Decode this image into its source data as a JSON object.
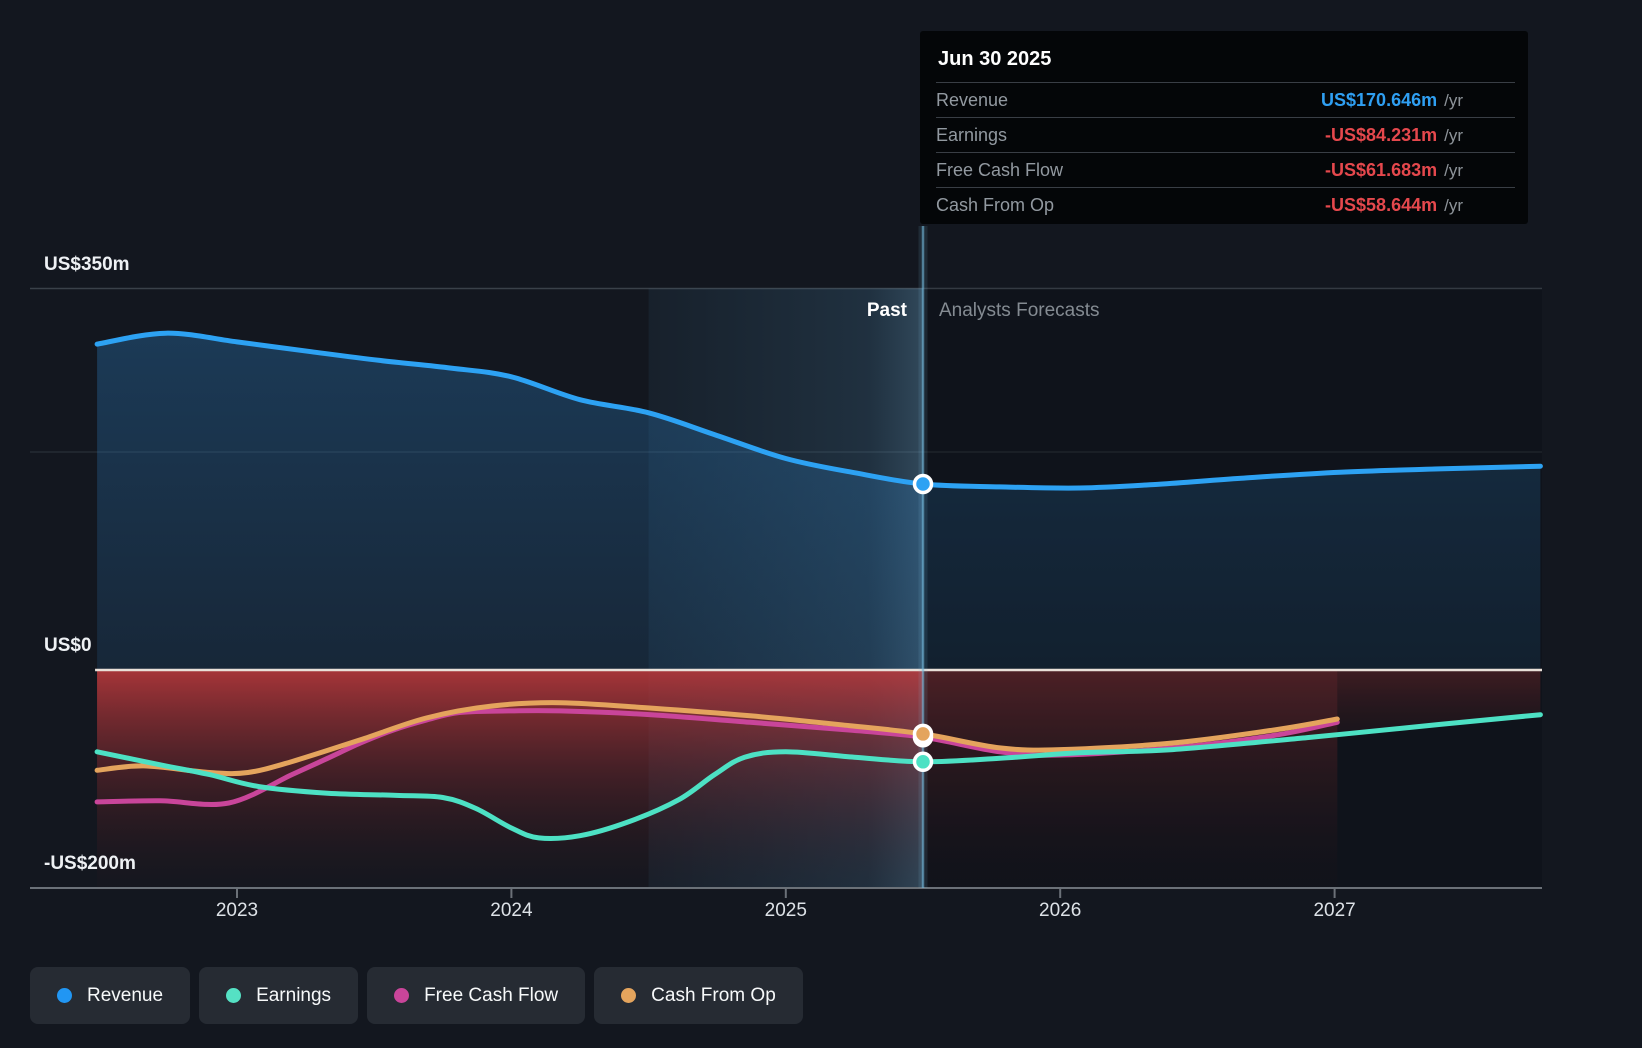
{
  "tooltip": {
    "date": "Jun 30 2025",
    "rows": [
      {
        "label": "Revenue",
        "value": "US$170.646m",
        "suffix": "/yr",
        "value_color": "#2f9ff2"
      },
      {
        "label": "Earnings",
        "value": "-US$84.231m",
        "suffix": "/yr",
        "value_color": "#e5484d"
      },
      {
        "label": "Free Cash Flow",
        "value": "-US$61.683m",
        "suffix": "/yr",
        "value_color": "#e5484d"
      },
      {
        "label": "Cash From Op",
        "value": "-US$58.644m",
        "suffix": "/yr",
        "value_color": "#e5484d"
      }
    ]
  },
  "annotations": {
    "past": "Past",
    "forecast": "Analysts Forecasts"
  },
  "legend": [
    {
      "label": "Revenue",
      "color": "#2196f3"
    },
    {
      "label": "Earnings",
      "color": "#55e1c4"
    },
    {
      "label": "Free Cash Flow",
      "color": "#c9459a"
    },
    {
      "label": "Cash From Op",
      "color": "#e4a45d"
    }
  ],
  "chart_data": {
    "type": "line",
    "unit": "US$m",
    "x_axis": {
      "ticks": [
        2023,
        2024,
        2025,
        2026,
        2027
      ],
      "range": [
        2022.24,
        2027.76
      ],
      "grid": false
    },
    "y_axis": {
      "range": [
        -200,
        350
      ],
      "labeled_gridlines": [
        {
          "value": 350,
          "label": "US$350m"
        },
        {
          "value": 0,
          "label": "US$0"
        },
        {
          "value": -200,
          "label": "-US$200m"
        }
      ],
      "faint_gridline_value": 200
    },
    "divider": {
      "t": 2025.5,
      "date": "Jun 30 2025",
      "past_year_band": [
        2024.5,
        2025.5
      ]
    },
    "series": [
      {
        "name": "Revenue",
        "color": "#2da2f3",
        "marker": 170.646,
        "area": "blue",
        "points": [
          [
            2022.49,
            299
          ],
          [
            2022.74,
            309
          ],
          [
            2023.0,
            301
          ],
          [
            2023.27,
            292
          ],
          [
            2023.52,
            284
          ],
          [
            2023.78,
            277
          ],
          [
            2024.0,
            269
          ],
          [
            2024.25,
            248
          ],
          [
            2024.5,
            236
          ],
          [
            2024.74,
            216
          ],
          [
            2025.0,
            194
          ],
          [
            2025.25,
            181
          ],
          [
            2025.5,
            170.646
          ],
          [
            2025.78,
            168
          ],
          [
            2026.07,
            167
          ],
          [
            2026.36,
            170.5
          ],
          [
            2026.66,
            176
          ],
          [
            2027.02,
            181.5
          ],
          [
            2027.38,
            184.5
          ],
          [
            2027.75,
            187
          ]
        ]
      },
      {
        "name": "Earnings",
        "color": "#4de1c4",
        "marker": -84.231,
        "area": "red-tail",
        "points": [
          [
            2022.49,
            -75
          ],
          [
            2022.72,
            -87
          ],
          [
            2022.9,
            -96
          ],
          [
            2023.08,
            -107
          ],
          [
            2023.33,
            -113
          ],
          [
            2023.58,
            -115
          ],
          [
            2023.75,
            -117
          ],
          [
            2023.87,
            -127
          ],
          [
            2024.0,
            -145
          ],
          [
            2024.1,
            -154
          ],
          [
            2024.25,
            -152
          ],
          [
            2024.43,
            -139
          ],
          [
            2024.61,
            -119
          ],
          [
            2024.74,
            -96
          ],
          [
            2024.85,
            -80
          ],
          [
            2025.0,
            -75
          ],
          [
            2025.25,
            -80
          ],
          [
            2025.5,
            -84.231
          ],
          [
            2025.78,
            -81
          ],
          [
            2026.07,
            -76
          ],
          [
            2026.41,
            -73
          ],
          [
            2026.9,
            -62
          ],
          [
            2027.38,
            -50
          ],
          [
            2027.75,
            -41
          ]
        ]
      },
      {
        "name": "Free Cash Flow",
        "color": "#c9459a",
        "marker": -61.683,
        "area": null,
        "points": [
          [
            2022.49,
            -121
          ],
          [
            2022.72,
            -120
          ],
          [
            2022.97,
            -122
          ],
          [
            2023.2,
            -96
          ],
          [
            2023.33,
            -81
          ],
          [
            2023.45,
            -67
          ],
          [
            2023.57,
            -55
          ],
          [
            2023.69,
            -46
          ],
          [
            2023.81,
            -39
          ],
          [
            2024.0,
            -37.5
          ],
          [
            2024.18,
            -37.5
          ],
          [
            2024.51,
            -41
          ],
          [
            2024.87,
            -48
          ],
          [
            2025.23,
            -55
          ],
          [
            2025.5,
            -61.683
          ],
          [
            2025.78,
            -75
          ],
          [
            2026.0,
            -78
          ],
          [
            2026.41,
            -71.5
          ],
          [
            2026.78,
            -60
          ],
          [
            2027.01,
            -48
          ]
        ]
      },
      {
        "name": "Cash From Op",
        "color": "#e4a45d",
        "marker": -58.644,
        "area": null,
        "points": [
          [
            2022.49,
            -92
          ],
          [
            2022.66,
            -88
          ],
          [
            2022.9,
            -94
          ],
          [
            2023.04,
            -94
          ],
          [
            2023.2,
            -84
          ],
          [
            2023.45,
            -64
          ],
          [
            2023.69,
            -44
          ],
          [
            2023.93,
            -33
          ],
          [
            2024.18,
            -30
          ],
          [
            2024.51,
            -35
          ],
          [
            2024.87,
            -42
          ],
          [
            2025.23,
            -51
          ],
          [
            2025.5,
            -58.644
          ],
          [
            2025.78,
            -71.5
          ],
          [
            2026.0,
            -73
          ],
          [
            2026.41,
            -67
          ],
          [
            2026.78,
            -55
          ],
          [
            2027.01,
            -45
          ]
        ]
      }
    ]
  }
}
